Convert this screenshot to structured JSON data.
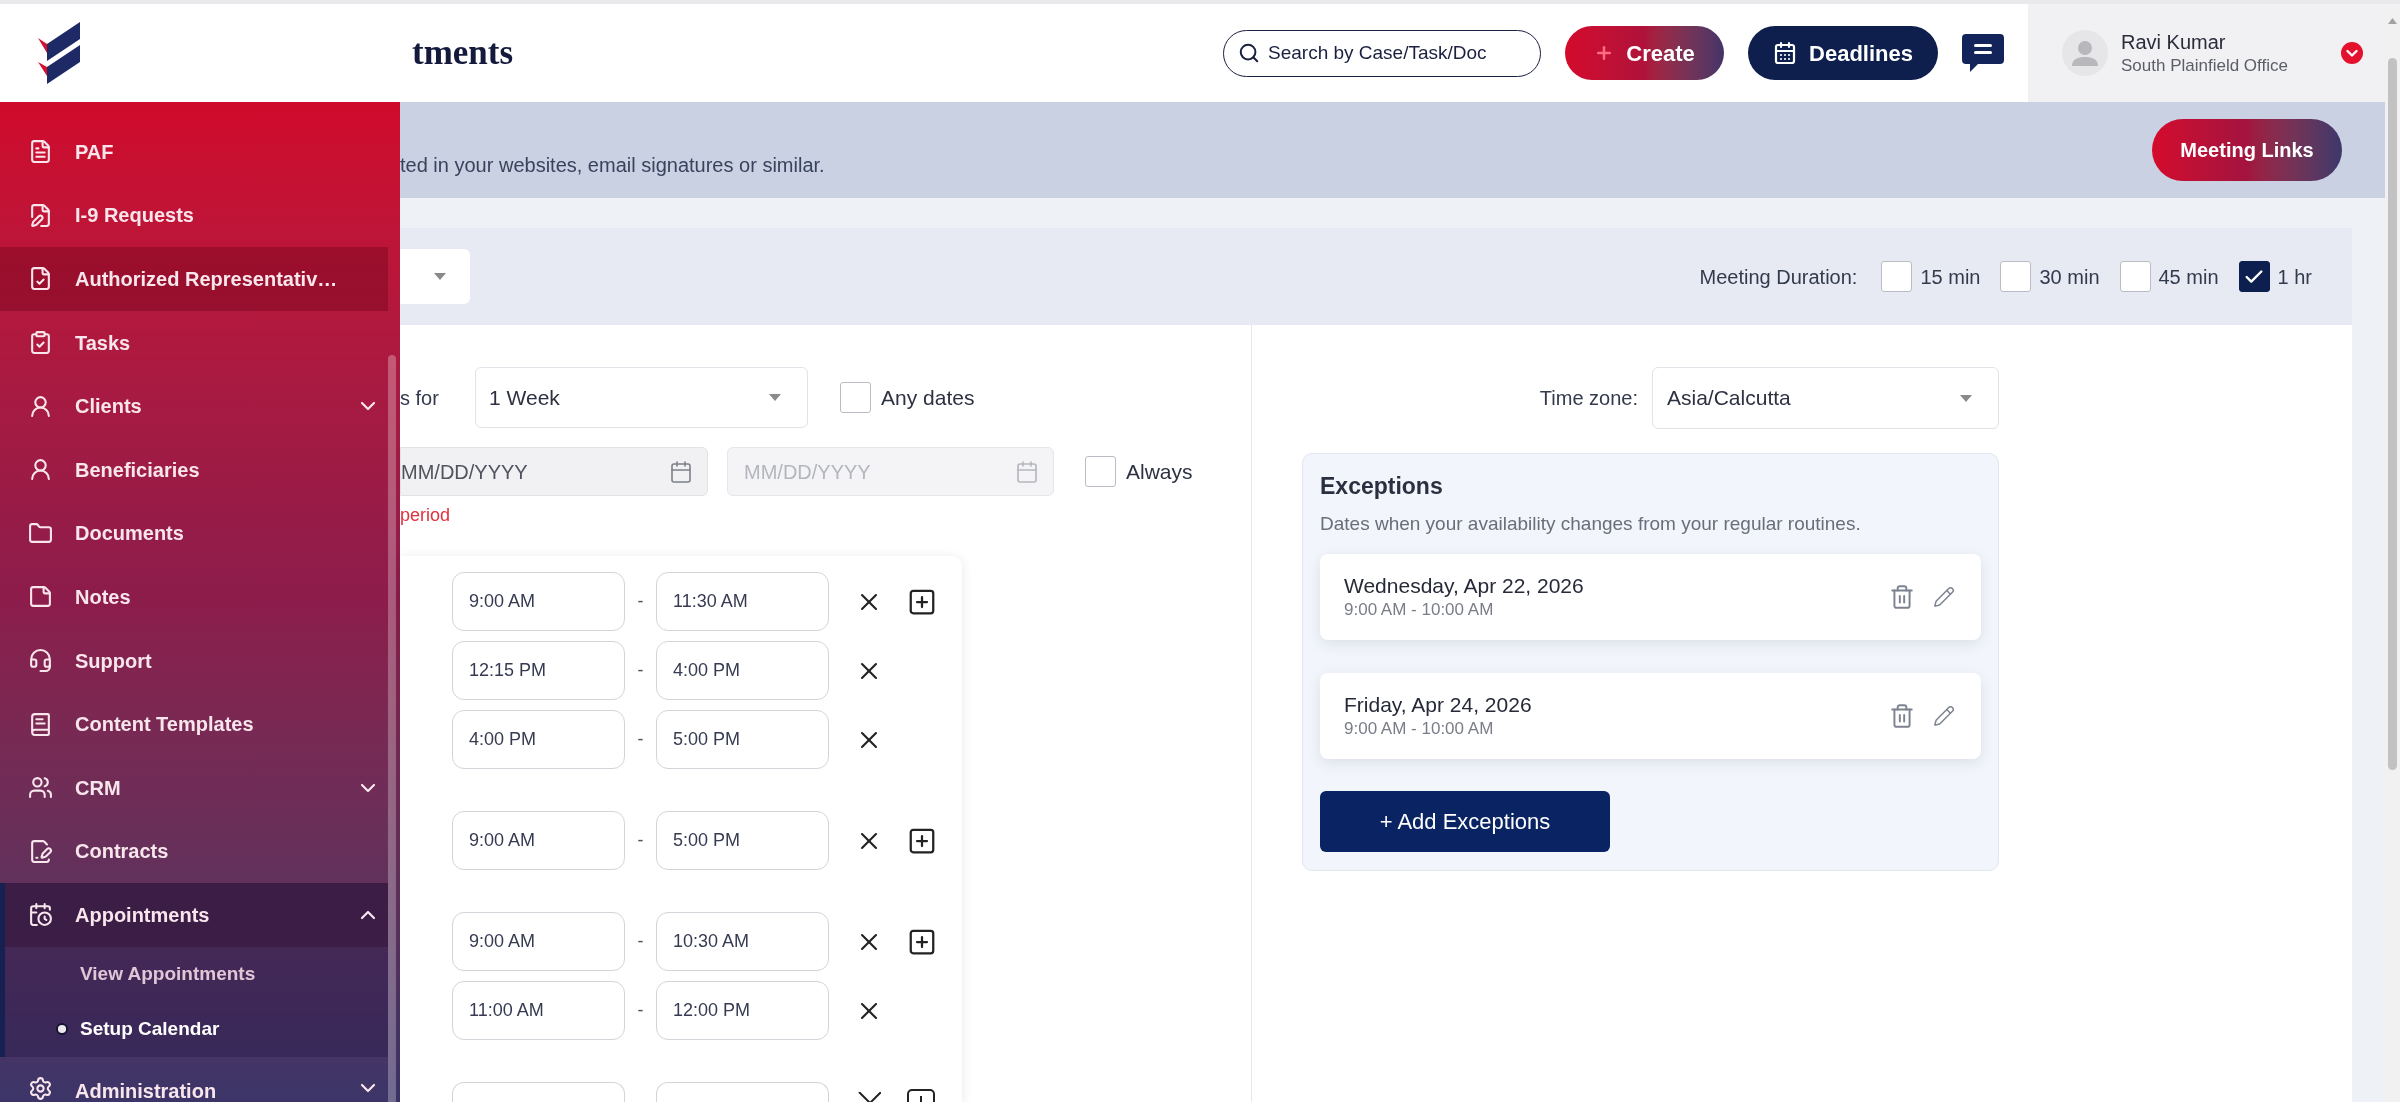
{
  "header": {
    "title": "tments",
    "search": {
      "placeholder": "Search by Case/Task/Doc"
    },
    "create_button": "Create",
    "deadlines_button": "Deadlines",
    "user": {
      "name": "Ravi Kumar",
      "office": "South Plainfield Office"
    }
  },
  "sidebar": {
    "items": [
      {
        "label": "PAF",
        "hovered": false
      },
      {
        "label": "I-9 Requests",
        "hovered": false
      },
      {
        "label": "Authorized Representativ…",
        "hovered": true
      },
      {
        "label": "Tasks",
        "hovered": false
      },
      {
        "label": "Clients",
        "hovered": false,
        "expanded": false
      },
      {
        "label": "Beneficiaries",
        "hovered": false
      },
      {
        "label": "Documents",
        "hovered": false
      },
      {
        "label": "Notes",
        "hovered": false
      },
      {
        "label": "Support",
        "hovered": false
      },
      {
        "label": "Content Templates",
        "hovered": false
      },
      {
        "label": "CRM",
        "hovered": false,
        "expanded": false
      },
      {
        "label": "Contracts",
        "hovered": false
      },
      {
        "label": "Appointments",
        "hovered": false,
        "expanded": true,
        "children": [
          {
            "label": "View Appointments",
            "selected": false
          },
          {
            "label": "Setup Calendar",
            "selected": true
          }
        ]
      },
      {
        "label": "Administration",
        "hovered": false,
        "expanded": false
      }
    ]
  },
  "banner": {
    "text": "ted in your websites, email signatures or similar.",
    "button": "Meeting Links"
  },
  "toolbar": {
    "label": "Meeting Duration:",
    "durations": [
      {
        "label": "15 min",
        "checked": false
      },
      {
        "label": "30 min",
        "checked": false
      },
      {
        "label": "45 min",
        "checked": false
      },
      {
        "label": "1 hr",
        "checked": true
      }
    ]
  },
  "schedule": {
    "range_label": "s for",
    "range": "1 Week",
    "any_dates": {
      "label": "Any dates",
      "checked": false
    },
    "start_date": {
      "placeholder": "MM/DD/YYYY",
      "disabled": false
    },
    "end_date": {
      "placeholder": "MM/DD/YYYY",
      "disabled": true
    },
    "always": {
      "label": "Always",
      "checked": false
    },
    "error": "period",
    "slot_groups": [
      {
        "kind": "full",
        "slots": [
          {
            "from": "9:00 AM",
            "separator": "-",
            "to": "11:30 AM"
          },
          {
            "from": "12:15 PM",
            "separator": "-",
            "to": "4:00 PM"
          },
          {
            "from": "4:00 PM",
            "separator": "-",
            "to": "5:00 PM"
          }
        ]
      },
      {
        "kind": "full",
        "slots": [
          {
            "from": "9:00 AM",
            "separator": "-",
            "to": "5:00 PM"
          }
        ]
      },
      {
        "kind": "full",
        "slots": [
          {
            "from": "9:00 AM",
            "separator": "-",
            "to": "10:30 AM"
          },
          {
            "from": "11:00 AM",
            "separator": "-",
            "to": "12:00 PM"
          }
        ]
      },
      {
        "kind": "clipped"
      }
    ]
  },
  "timezone": {
    "label": "Time zone:",
    "value": "Asia/Calcutta"
  },
  "exceptions": {
    "title": "Exceptions",
    "description": "Dates when your availability changes from your regular routines.",
    "items": [
      {
        "date": "Wednesday, Apr 22, 2026",
        "time": "9:00 AM - 10:00 AM"
      },
      {
        "date": "Friday, Apr 24, 2026",
        "time": "9:00 AM - 10:00 AM"
      }
    ],
    "button": "+ Add Exceptions"
  }
}
